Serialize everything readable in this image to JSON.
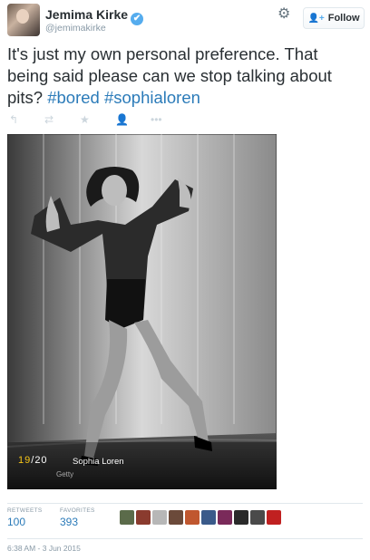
{
  "author": {
    "name": "Jemima Kirke",
    "handle": "@jemimakirke",
    "verified": true
  },
  "header": {
    "settings_icon": "gear-icon",
    "follow_label": "Follow"
  },
  "tweet": {
    "text_plain": "It's just my own personal preference. That being said please can we stop talking about pits? ",
    "hashtags": [
      "#bored",
      "#sophialoren"
    ]
  },
  "actions": [
    {
      "icon": "reply-icon"
    },
    {
      "icon": "retweet-icon"
    },
    {
      "icon": "favorite-icon"
    },
    {
      "icon": "follow-icon"
    },
    {
      "icon": "more-icon"
    }
  ],
  "media": {
    "counter_current": "19",
    "counter_sep": "/",
    "counter_total": "20",
    "caption": "Sophia Loren",
    "credit": "Getty"
  },
  "stats": {
    "retweets_label": "RETWEETS",
    "retweets_value": "100",
    "favorites_label": "FAVORITES",
    "favorites_value": "393"
  },
  "favoriters_colors": [
    "#5b6b4a",
    "#8a3b2e",
    "#b7b7b7",
    "#6b4a3a",
    "#c0572f",
    "#3a5a8a",
    "#7a2a5a",
    "#2a2a2a",
    "#4a4a4a",
    "#c02020"
  ],
  "timestamp": "6:38 AM - 3 Jun 2015",
  "colors": {
    "link": "#2b7bb9",
    "verified": "#55acee",
    "counter": "#f5c518"
  }
}
